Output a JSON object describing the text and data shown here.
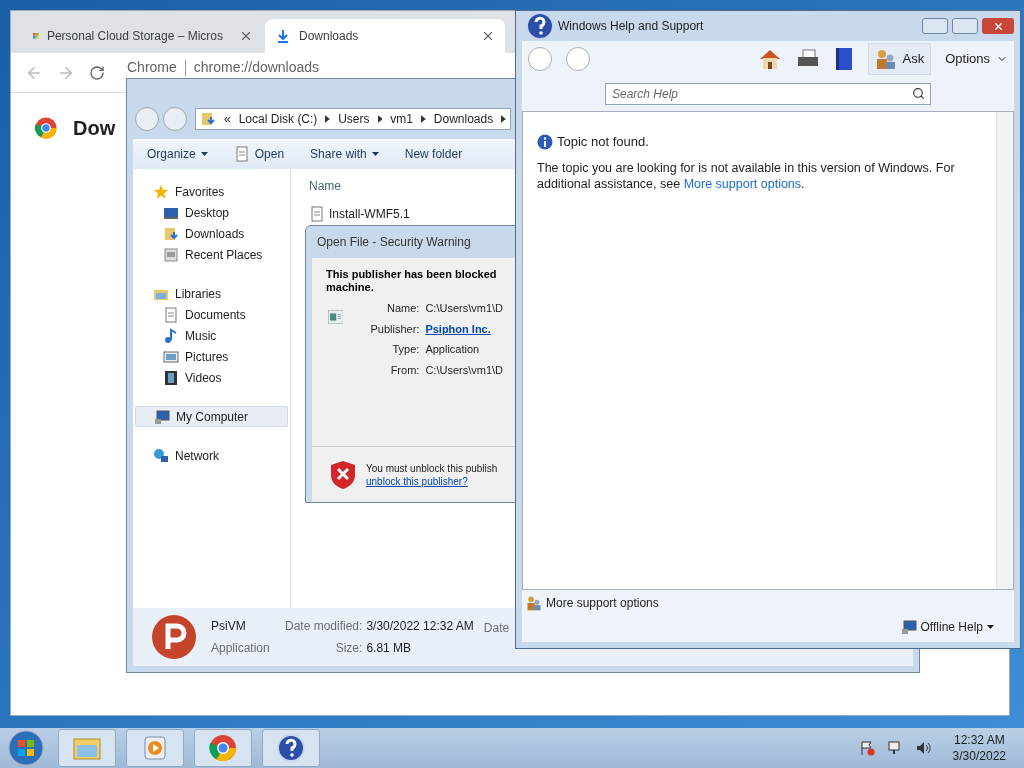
{
  "browser": {
    "tabs": [
      {
        "title": "Personal Cloud Storage – Micros",
        "kind": "tiles",
        "selected": false
      },
      {
        "title": "Downloads",
        "kind": "download",
        "selected": true
      }
    ],
    "address": {
      "site": "Chrome",
      "url": "chrome://downloads"
    },
    "page_heading": "Dow"
  },
  "explorer": {
    "breadcrumb_prefix": "«",
    "breadcrumb": [
      "Local Disk (C:)",
      "Users",
      "vm1",
      "Downloads"
    ],
    "toolbar": [
      {
        "label": "Organize",
        "kind": "menu"
      },
      {
        "label": "Open",
        "kind": "icon"
      },
      {
        "label": "Share with",
        "kind": "menu"
      },
      {
        "label": "New folder",
        "kind": "plain"
      }
    ],
    "nav": [
      {
        "label": "Favorites",
        "kind": "star",
        "selected": false,
        "children": [
          {
            "label": "Desktop",
            "kind": "desktop",
            "selected": false
          },
          {
            "label": "Downloads",
            "kind": "downloads",
            "selected": false
          },
          {
            "label": "Recent Places",
            "kind": "recent",
            "selected": false
          }
        ]
      },
      {
        "label": "Libraries",
        "kind": "library",
        "selected": false,
        "children": [
          {
            "label": "Documents",
            "kind": "documents",
            "selected": false
          },
          {
            "label": "Music",
            "kind": "music",
            "selected": false
          },
          {
            "label": "Pictures",
            "kind": "pictures",
            "selected": false
          },
          {
            "label": "Videos",
            "kind": "videos",
            "selected": false
          }
        ]
      },
      {
        "label": "My Computer",
        "kind": "computer",
        "selected": true
      },
      {
        "label": "Network",
        "kind": "network",
        "selected": false
      }
    ],
    "column": "Name",
    "files": [
      "Install-WMF5.1"
    ],
    "details": {
      "name": "PsiVM",
      "type": "Application",
      "fields": [
        {
          "label": "Date modified:",
          "value": "3/30/2022 12:32 AM"
        },
        {
          "label": "Size:",
          "value": "6.81 MB"
        }
      ],
      "column_3": "Date"
    }
  },
  "dialog": {
    "title": "Open File - Security Warning",
    "heading": [
      "This publisher has been blocked",
      "machine."
    ],
    "fields": [
      {
        "label": "Name:",
        "value": "C:\\Users\\vm1\\D",
        "kind": "text"
      },
      {
        "label": "Publisher:",
        "value": "Psiphon Inc.",
        "kind": "link"
      },
      {
        "label": "Type:",
        "value": "Application",
        "kind": "text"
      },
      {
        "label": "From:",
        "value": "C:\\Users\\vm1\\D",
        "kind": "text"
      }
    ],
    "footer_text": "You must unblock this publish",
    "footer_link": "unblock this publisher?"
  },
  "help": {
    "title": "Windows Help and Support",
    "ask": "Ask",
    "options": "Options",
    "search": {
      "placeholder": "Search Help"
    },
    "notice": "Topic not found.",
    "body": "The topic you are looking for is not available in this version of Windows. For additional assistance, see",
    "body_link": "More support options",
    "body_end": ".",
    "footer_link": "More support options",
    "offline": "Offline Help"
  },
  "taskbar": {
    "apps": [
      {
        "kind": "folder"
      },
      {
        "kind": "media"
      },
      {
        "kind": "chrome"
      },
      {
        "kind": "help"
      }
    ],
    "time": "12:32 AM",
    "date": "3/30/2022"
  }
}
